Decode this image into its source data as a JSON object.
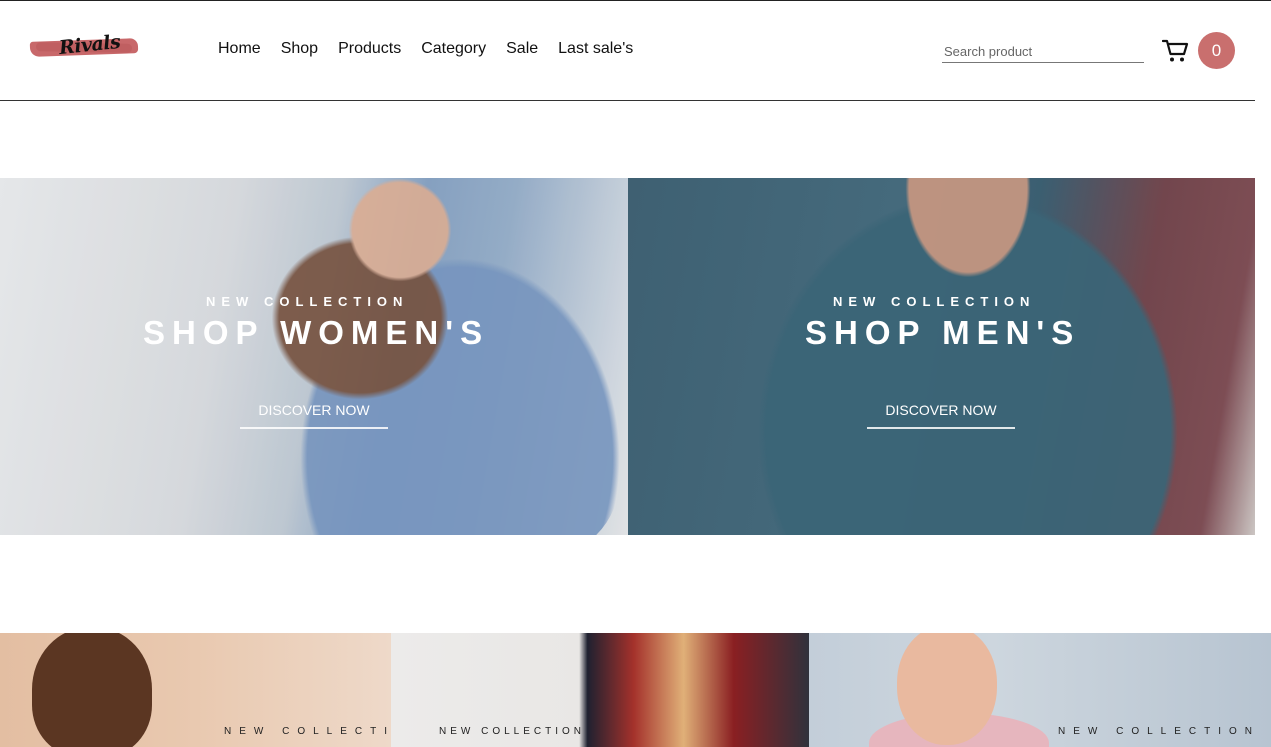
{
  "header": {
    "logo_text": "Rivals",
    "nav": [
      "Home",
      "Shop",
      "Products",
      "Category",
      "Sale",
      "Last sale's"
    ],
    "search_placeholder": "Search product",
    "cart_count": "0"
  },
  "hero": {
    "women": {
      "eyebrow": "NEW COLLECTION",
      "title": "SHOP WOMEN'S",
      "cta": "DISCOVER NOW"
    },
    "men": {
      "eyebrow": "NEW COLLECTION",
      "title": "SHOP MEN'S",
      "cta": "DISCOVER NOW"
    }
  },
  "collections": [
    {
      "label": "NEW COLLECTIO"
    },
    {
      "label": "NEW COLLECTION"
    },
    {
      "label": "NEW COLLECTION"
    }
  ],
  "colors": {
    "accent": "#c96f6e",
    "logo_brush": "#c8686a"
  },
  "icons": {
    "cart": "cart-icon"
  }
}
